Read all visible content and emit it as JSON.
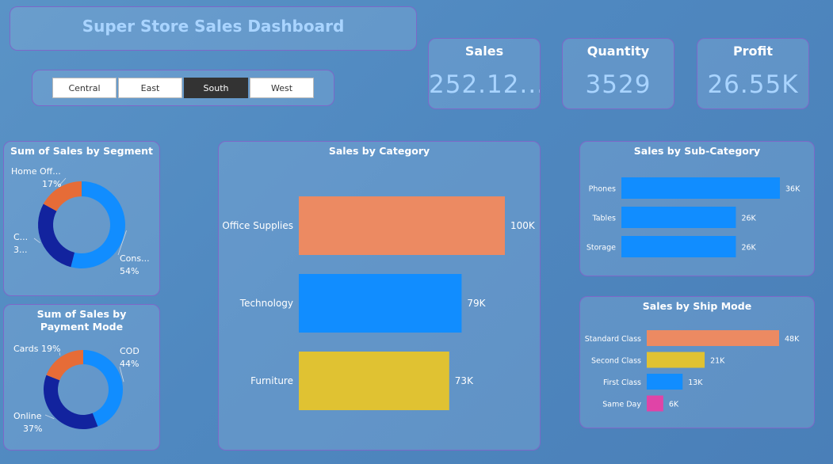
{
  "header": {
    "title": "Super Store Sales Dashboard"
  },
  "slicer": {
    "options": [
      "Central",
      "East",
      "South",
      "West"
    ],
    "selected": "South"
  },
  "kpis": {
    "sales": {
      "label": "Sales",
      "value": "252.12..."
    },
    "quantity": {
      "label": "Quantity",
      "value": "3529"
    },
    "profit": {
      "label": "Profit",
      "value": "26.55K"
    }
  },
  "colors": {
    "blue": "#118dff",
    "darkblue": "#12239e",
    "orange": "#e66c37",
    "salmon": "#ec8a62",
    "yellow": "#e0c232",
    "magenta": "#e044a7"
  },
  "chart_data": [
    {
      "id": "segment",
      "type": "pie",
      "subtype": "donut",
      "title": "Sum of Sales by Segment",
      "slices": [
        {
          "label": "Cons...",
          "percent_label": "54%",
          "value": 54,
          "color": "#118dff"
        },
        {
          "label": "C...",
          "percent_label": "3...",
          "value": 29,
          "color": "#12239e"
        },
        {
          "label": "Home Off...",
          "percent_label": "17%",
          "value": 17,
          "color": "#e66c37"
        }
      ]
    },
    {
      "id": "payment",
      "type": "pie",
      "subtype": "donut",
      "title": "Sum of Sales by Payment Mode",
      "slices": [
        {
          "label": "COD",
          "percent_label": "44%",
          "value": 44,
          "color": "#118dff"
        },
        {
          "label": "Online",
          "percent_label": "37%",
          "value": 37,
          "color": "#12239e"
        },
        {
          "label": "Cards",
          "percent_label": "19%",
          "value": 19,
          "color": "#e66c37"
        }
      ]
    },
    {
      "id": "category",
      "type": "bar",
      "orientation": "horizontal",
      "title": "Sales by Category",
      "categories": [
        "Office Supplies",
        "Technology",
        "Furniture"
      ],
      "values": [
        100,
        79,
        73
      ],
      "value_labels": [
        "100K",
        "79K",
        "73K"
      ],
      "colors": [
        "#ec8a62",
        "#118dff",
        "#e0c232"
      ],
      "xlim": [
        0,
        100
      ]
    },
    {
      "id": "subcategory",
      "type": "bar",
      "orientation": "horizontal",
      "title": "Sales by Sub-Category",
      "categories": [
        "Phones",
        "Tables",
        "Storage"
      ],
      "values": [
        36,
        26,
        26
      ],
      "value_labels": [
        "36K",
        "26K",
        "26K"
      ],
      "colors": [
        "#118dff",
        "#118dff",
        "#118dff"
      ],
      "xlim": [
        0,
        36
      ]
    },
    {
      "id": "shipmode",
      "type": "bar",
      "orientation": "horizontal",
      "title": "Sales by Ship Mode",
      "categories": [
        "Standard Class",
        "Second Class",
        "First Class",
        "Same Day"
      ],
      "values": [
        48,
        21,
        13,
        6
      ],
      "value_labels": [
        "48K",
        "21K",
        "13K",
        "6K"
      ],
      "colors": [
        "#ec8a62",
        "#e0c232",
        "#118dff",
        "#e044a7"
      ],
      "xlim": [
        0,
        48
      ]
    }
  ]
}
